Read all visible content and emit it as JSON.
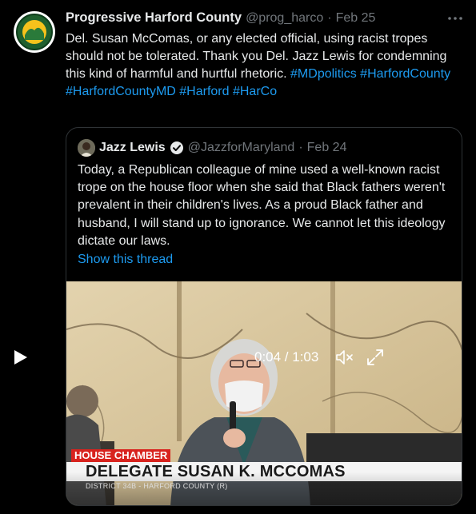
{
  "tweet": {
    "author_name": "Progressive Harford County",
    "author_handle": "@prog_harco",
    "separator": "·",
    "date": "Feb 25",
    "text": "Del. Susan McComas, or any elected official, using racist tropes should not be tolerated. Thank you Del. Jazz Lewis for condemning this kind of harmful and hurtful rhetoric.",
    "hashtags": "#MDpolitics #HarfordCounty #HarfordCountyMD #Harford #HarCo",
    "avatar_icon": "progressive-harford-county-logo-icon",
    "more_icon": "more-options-icon"
  },
  "quoted_tweet": {
    "author_name": "Jazz Lewis",
    "author_handle": "@JazzforMaryland",
    "separator": "·",
    "date": "Feb 24",
    "verified_icon": "verified-badge-icon",
    "text": "Today, a Republican colleague of mine used a well-known racist trope on the house floor when she said that Black fathers weren't prevalent in their children's lives. As a proud Black father and husband, I will stand up to ignorance. We cannot let this ideology dictate our laws.",
    "show_thread": "Show this thread",
    "video": {
      "chyron_top": "HOUSE CHAMBER",
      "chyron_title": "DELEGATE SUSAN K. MCCOMAS",
      "chyron_subtitle": "DISTRICT 34B - HARFORD COUNTY (R)",
      "time": "0:04 / 1:03",
      "play_icon": "play-icon",
      "mute_icon": "muted-speaker-icon",
      "fullscreen_icon": "fullscreen-icon"
    }
  },
  "colors": {
    "background": "#000000",
    "text": "#e7e9ea",
    "secondary": "#71767b",
    "link": "#1d9bf0",
    "border": "#2f3336",
    "chyron_red": "#d8231e"
  }
}
